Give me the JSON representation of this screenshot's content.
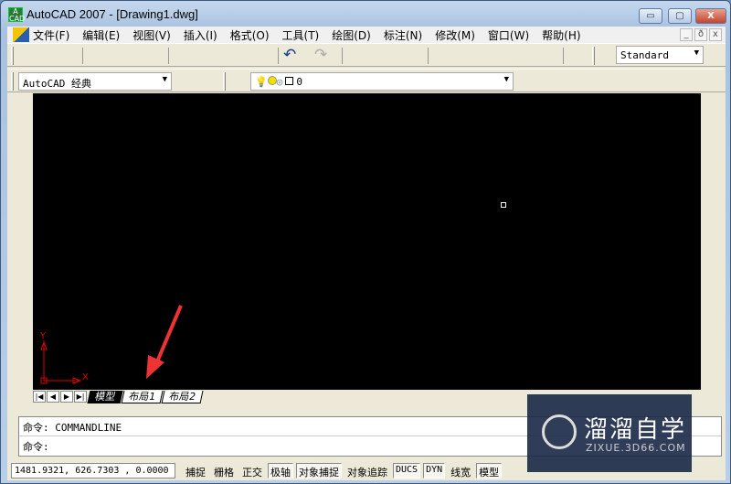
{
  "window": {
    "title": "AutoCAD 2007 - [Drawing1.dwg]",
    "minimize": "▭",
    "maximize": "▢",
    "close": "X"
  },
  "menu": [
    "文件(F)",
    "编辑(E)",
    "视图(V)",
    "插入(I)",
    "格式(O)",
    "工具(T)",
    "绘图(D)",
    "标注(N)",
    "修改(M)",
    "窗口(W)",
    "帮助(H)"
  ],
  "mdi": {
    "minimize": "_",
    "restore": "ð",
    "close": "x"
  },
  "toolbar": {
    "undo": "↶",
    "redo": "↷",
    "style_combo": "Standard",
    "workspace_combo": "AutoCAD 经典",
    "layer_combo": "0"
  },
  "tabs": {
    "nav": [
      "|◀",
      "◀",
      "▶",
      "▶|"
    ],
    "items": [
      "模型",
      "布局1",
      "布局2"
    ]
  },
  "ucs": {
    "x": "X",
    "y": "Y"
  },
  "command": {
    "history": "命令: COMMANDLINE",
    "prompt": "命令:"
  },
  "status": {
    "coords": "1481.9321, 626.7303 , 0.0000",
    "buttons": [
      {
        "label": "捕捉",
        "on": false
      },
      {
        "label": "栅格",
        "on": false
      },
      {
        "label": "正交",
        "on": false
      },
      {
        "label": "极轴",
        "on": true
      },
      {
        "label": "对象捕捉",
        "on": true
      },
      {
        "label": "对象追踪",
        "on": false
      },
      {
        "label": "DUCS",
        "on": true
      },
      {
        "label": "DYN",
        "on": true
      },
      {
        "label": "线宽",
        "on": false
      },
      {
        "label": "模型",
        "on": true
      }
    ]
  },
  "watermark": {
    "name": "溜溜自学",
    "url": "ZIXUE.3D66.COM"
  }
}
